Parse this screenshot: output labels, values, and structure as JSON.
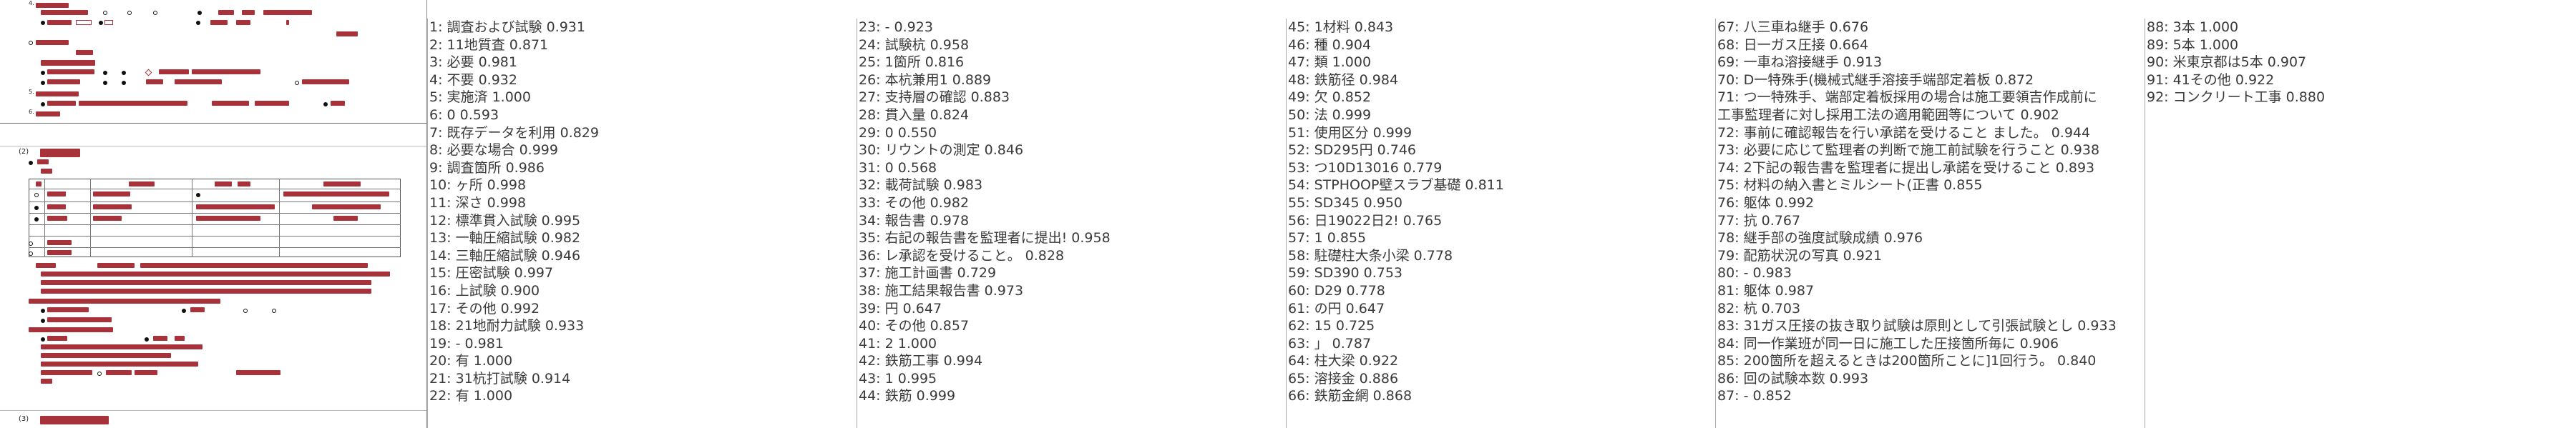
{
  "document": {
    "section_number_top": "4.",
    "section_heading": "鉄筋工事",
    "section_heading_number": "(2)",
    "bottom_heading_number": "(3)",
    "bottom_heading": "コンクリート工事",
    "sub_markers": [
      "5.",
      "6."
    ]
  },
  "ocr_columns": [
    {
      "lines": [
        "1: 調査および試験  0.931",
        "2: 11地質査  0.871",
        "3: 必要  0.981",
        "4: 不要  0.932",
        "5: 実施済  1.000",
        "6: 0  0.593",
        "7: 既存データを利用  0.829",
        "8: 必要な場合  0.999",
        "9: 調査箇所  0.986",
        "10: ヶ所  0.998",
        "11: 深さ  0.998",
        "12: 標準貫入試験  0.995",
        "13: 一軸圧縮試験  0.982",
        "14: 三軸圧縮試験  0.946",
        "15: 圧密試験  0.997",
        "16: 上試験  0.900",
        "17: その他  0.992",
        "18: 21地耐力試験  0.933",
        "19: -  0.981",
        "20: 有  1.000",
        "21: 31杭打試験  0.914",
        "22: 有  1.000"
      ]
    },
    {
      "lines": [
        "23: -  0.923",
        "24: 試験杭  0.958",
        "25: 1箇所  0.816",
        "26: 本杭兼用1  0.889",
        "27: 支持層の確認  0.883",
        "28: 貫入量  0.824",
        "29: 0  0.550",
        "30: リウントの測定  0.846",
        "31: 0  0.568",
        "32: 載荷試験  0.983",
        "33: その他  0.982",
        "34: 報告書  0.978",
        "35: 右記の報告書を監理者に提出!  0.958",
        "36: レ承認を受けること。  0.828",
        "37: 施工計画書  0.729",
        "38: 施工結果報告書  0.973",
        "39: 円  0.647",
        "40: その他  0.857",
        "41: 2  1.000",
        "42: 鉄筋工事  0.994",
        "43: 1  0.995",
        "44: 鉄筋  0.999"
      ]
    },
    {
      "lines": [
        "45: 1材料  0.843",
        "46: 種  0.904",
        "47: 類  1.000",
        "48: 鉄筋径  0.984",
        "49: 欠  0.852",
        "50: 法  0.999",
        "51: 使用区分  0.999",
        "52: SD295円  0.746",
        "53: つ10D13016  0.779",
        "54: STPHOOP壁スラブ基礎  0.811",
        "55: SD345  0.950",
        "56: 日19022日2!  0.765",
        "57: 1  0.855",
        "58: 駐礎柱大条小梁  0.778",
        "59: SD390  0.753",
        "60: D29  0.778",
        "61: の円  0.647",
        "62: 15  0.725",
        "63: 」  0.787",
        "64: 柱大梁  0.922",
        "65: 溶接金  0.886",
        "66: 鉄筋金網  0.868"
      ]
    },
    {
      "lines": [
        "67: 八三車ね継手  0.676",
        "68: 日一ガス圧接  0.664",
        "69: 一車ね溶接継手  0.913",
        "70: D一特殊手(機械式継手溶接手端部定着板  0.872",
        "71: つ一特殊手、端部定着板採用の場合は施工要領吉作成前に",
        "工事監理者に対し採用工法の適用範囲等について  0.902",
        "72: 事前に確認報告を行い承諾を受けること ました。  0.944",
        "73: 必要に応じて監理者の判断で施工前試験を行うこと  0.938",
        "74: 2下記の報告書を監理者に提出し承諾を受けること  0.893",
        "75: 材料の納入書とミルシート(正書  0.855",
        "76: 躯体  0.992",
        "77: 抗  0.767",
        "78: 継手部の強度試験成績  0.976",
        "79: 配筋状況の写真  0.921",
        "80: -  0.983",
        "81: 躯体  0.987",
        "82: 杭  0.703",
        "83: 31ガス圧接の抜き取り試験は原則として引張試験とし  0.933",
        "84: 同一作業班が同一日に施工した圧接箇所毎に  0.906",
        "85: 200箇所を超えるときは200箇所ことに]1回行う。  0.840",
        "86: 回の試験本数  0.993",
        "87: -  0.852"
      ]
    },
    {
      "lines": [
        "88: 3本  1.000",
        "89: 5本  1.000",
        "90: 米東京都は5本  0.907",
        "91: 41その他  0.922",
        "92: コンクリート工事  0.880"
      ]
    }
  ]
}
